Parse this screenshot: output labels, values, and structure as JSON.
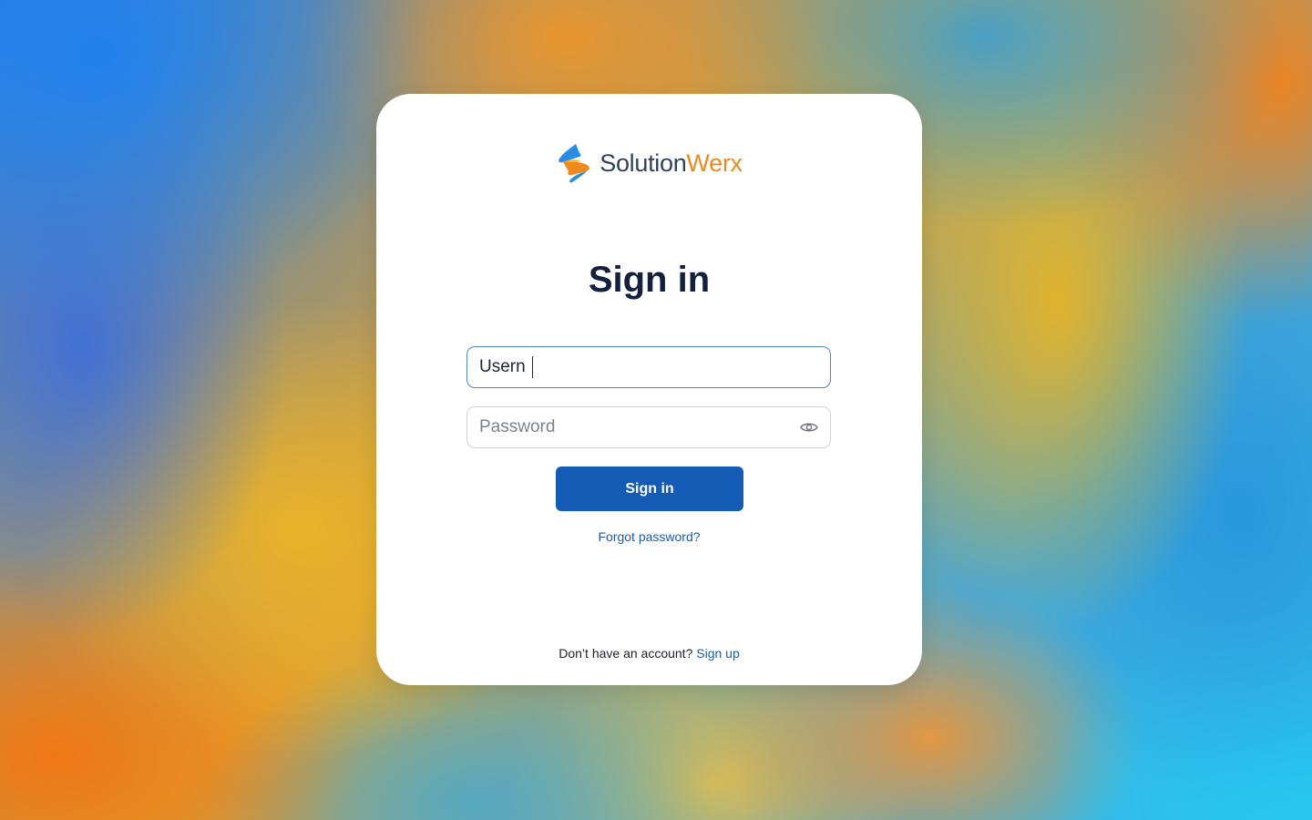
{
  "brand": {
    "name_part1": "Solution",
    "name_part2": "Werx",
    "logo_icon": "solutionwerx-logo-icon",
    "colors": {
      "primary": "#135bb5",
      "accent_orange": "#e78a1f",
      "text_dark": "#12213d"
    }
  },
  "form": {
    "title": "Sign in",
    "username": {
      "value": "Usern "
    },
    "password": {
      "placeholder": "Password",
      "toggle_icon": "eye-icon"
    },
    "submit_label": "Sign in",
    "forgot_label": "Forgot password?"
  },
  "footer": {
    "prompt": "Don’t have an account?",
    "signup_label": "Sign up"
  }
}
